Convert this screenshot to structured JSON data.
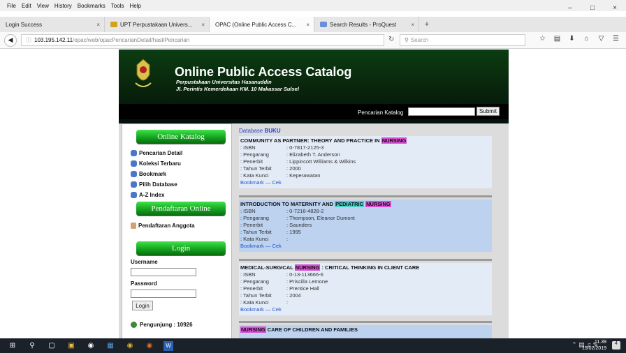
{
  "menubar": [
    "File",
    "Edit",
    "View",
    "History",
    "Bookmarks",
    "Tools",
    "Help"
  ],
  "window_controls": [
    "–",
    "□",
    "×"
  ],
  "tabs": [
    {
      "title": "Login Success",
      "active": false
    },
    {
      "title": "UPT Perpustakaan Univers...",
      "active": false
    },
    {
      "title": "OPAC (Online Public Access C...",
      "active": true
    },
    {
      "title": "Search Results - ProQuest",
      "active": false
    }
  ],
  "tab_close_glyph": "×",
  "new_tab_glyph": "+",
  "url": {
    "host": "103.195.142.11",
    "path": "/opac/web/opacPencarianDetail/hasilPencarian"
  },
  "browser_search_placeholder": "Search",
  "banner": {
    "title": "Online Public Access Catalog",
    "subtitle1": "Perpustakaan Universitas Hasanuddin",
    "subtitle2": "Jl. Perintis Kemerdekaan KM. 10 Makassar Sulsel",
    "search_label": "Pencarian Katalog",
    "submit": "Submit"
  },
  "sidebar": {
    "online_katalog": "Online Katalog",
    "items": [
      "Pencarian Detail",
      "Koleksi Terbaru",
      "Bookmark",
      "Pilih Database",
      "A-Z Index"
    ],
    "pendaftaran_online": "Pendaftaran Online",
    "pendaftaran_anggota": "Pendaftaran Anggota",
    "login_header": "Login",
    "username_label": "Username",
    "password_label": "Password",
    "login_button": "Login",
    "visitors": "Pengunjung : 10926"
  },
  "results": {
    "database_label": "Database",
    "database_name": "BUKU",
    "field_labels": {
      "isbn": ": ISBN",
      "pengarang": ": Pengarang",
      "penerbit": ": Penerbit",
      "tahun": ": Tahun Terbit",
      "kata_kunci": ": Kata Kunci"
    },
    "bookmark_link": "Bookmark",
    "link_sep": " — ",
    "cek_link": "Cek",
    "records": [
      {
        "title_pre": "COMMUNITY AS PARTNER: THEORY AND PRACTICE IN ",
        "title_hl": "NURSING",
        "title_post": "",
        "isbn": ": 0-7817-2125-3",
        "pengarang": ": Elizabeth T. Anderson",
        "penerbit": ": Lippincott Williams & Wilkins",
        "tahun": ": 2000",
        "kata_kunci": ": Keperawatan"
      },
      {
        "title_pre": "INTRODUCTION TO MATERNITY AND ",
        "title_hl": "PEDIATRIC",
        "title_hl2": "NURSING",
        "title_post": "",
        "isbn": ": 0-7216-4828-2",
        "pengarang": ": Thompson, Eleanor Dumont",
        "penerbit": ": Saunders",
        "tahun": ": 1995",
        "kata_kunci": ":"
      },
      {
        "title_pre": "MEDICAL-SURGICAL ",
        "title_hl": "NURSING",
        "title_post": " : CRITICAL THINKING IN CLIENT CARE",
        "isbn": ": 0-13-113666-6",
        "pengarang": ": Priscilla Lemone",
        "penerbit": ": Prentice Hall",
        "tahun": ": 2004",
        "kata_kunci": ":"
      },
      {
        "title_pre": "",
        "title_hl": "NURSING",
        "title_post": " CARE OF CHILDREN AND FAMILIES"
      }
    ]
  },
  "taskbar": {
    "time": "11.39",
    "date": "15/02/2019",
    "notif_count": "4"
  }
}
